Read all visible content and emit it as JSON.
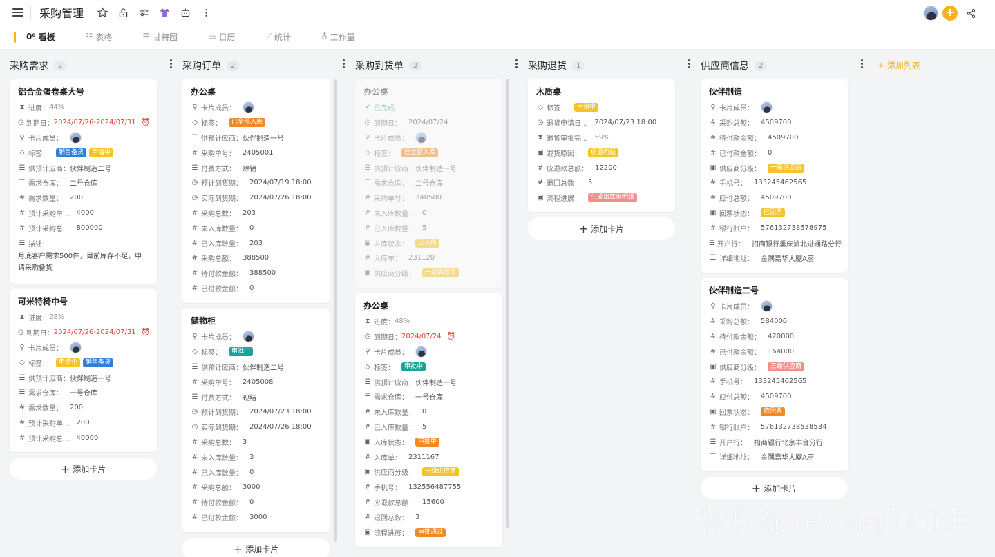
{
  "app": {
    "title": "采购管理"
  },
  "tabs": [
    {
      "icon": "0⁰",
      "label": "看板"
    },
    {
      "icon": "☷",
      "label": "表格"
    },
    {
      "icon": "☰",
      "label": "甘特图"
    },
    {
      "icon": "▭",
      "label": "日历"
    },
    {
      "icon": "⟋",
      "label": "统计"
    },
    {
      "icon": "♁",
      "label": "工作量"
    }
  ],
  "board": {
    "add_card_label": "添加卡片",
    "add_list_label": "添加列表",
    "columns": [
      {
        "name": "采购需求",
        "count": "2"
      },
      {
        "name": "采购订单",
        "count": "2"
      },
      {
        "name": "采购到货单",
        "count": "2"
      },
      {
        "name": "采购退货",
        "count": "1"
      },
      {
        "name": "供应商信息",
        "count": "2"
      }
    ]
  },
  "cards": {
    "c1a": {
      "title": "铝合金蛋卷桌大号",
      "progress": "44%",
      "due": "2024/07/26-2024/07/31",
      "label_progress": "进度：",
      "label_due": "到期日：",
      "label_member": "卡片成员：",
      "label_tag": "标签：",
      "tags": [
        "销售备货",
        "申请中"
      ],
      "label_supplier": "供预计应商：",
      "supplier": "伙伴制造二号",
      "label_warehouse": "需求仓库：",
      "warehouse": "二号仓库",
      "label_qty": "需求数量：",
      "qty": "200",
      "label_unit": "预计采购单...",
      "unit": "4000",
      "label_total": "预计采购总...",
      "total": "800000",
      "label_desc": "描述：",
      "desc": "月底客户需求500件，目前库存不足，申请采购备货"
    },
    "c1b": {
      "title": "可米特椅中号",
      "progress": "28%",
      "due": "2024/07/26-2024/07/31",
      "label_progress": "进度：",
      "label_due": "到期日：",
      "label_member": "卡片成员：",
      "label_tag": "标签：",
      "tags": [
        "申请中",
        "销售备货"
      ],
      "label_supplier": "供预计应商：",
      "supplier": "伙伴制造一号",
      "label_warehouse": "需求仓库：",
      "warehouse": "一号仓库",
      "label_qty": "需求数量：",
      "qty": "200",
      "label_unit": "预计采购单...",
      "unit": "200",
      "label_total": "预计采购总...",
      "total": "40000"
    },
    "c2a": {
      "title": "办公桌",
      "label_member": "卡片成员：",
      "label_tag": "标签：",
      "tags": [
        "已全部入库"
      ],
      "label_supplier": "供预计应商：",
      "supplier": "伙伴制造一号",
      "label_order": "采购单号：",
      "order": "2405001",
      "label_pay": "付费方式：",
      "pay": "赊销",
      "label_plan": "预计到货期：",
      "plan": "2024/07/19 18:00",
      "label_actual": "实际到货期：",
      "actual": "2024/07/26 18:00",
      "label_sum": "采购总数：",
      "sum": "203",
      "label_notin": "未入库数量：",
      "notin": "0",
      "label_in": "已入库数量：",
      "in": "203",
      "label_amount": "采购总额：",
      "amount": "388500",
      "label_topay": "待付款金额：",
      "topay": "388500",
      "label_paid": "已付款金额：",
      "paid": "0"
    },
    "c2b": {
      "title": "储物柜",
      "label_member": "卡片成员：",
      "label_tag": "标签：",
      "tags": [
        "审批中"
      ],
      "label_supplier": "供预计应商：",
      "supplier": "伙伴制造二号",
      "label_order": "采购单号：",
      "order": "2405008",
      "label_pay": "付费方式：",
      "pay": "现结",
      "label_plan": "预计到货期：",
      "plan": "2024/07/23 18:00",
      "label_actual": "实际到货期：",
      "actual": "2024/07/26 18:00",
      "label_sum": "采购总数：",
      "sum": "3",
      "label_notin": "未入库数量：",
      "notin": "3",
      "label_in": "已入库数量：",
      "in": "0",
      "label_amount": "采购总额：",
      "amount": "3000",
      "label_topay": "待付款金额：",
      "topay": "0",
      "label_paid": "已付款金额：",
      "paid": "3000"
    },
    "c3a": {
      "title": "办公桌",
      "status": "已完成",
      "label_due": "到期日：",
      "due": "2024/07/24",
      "label_member": "卡片成员：",
      "label_tag": "标签：",
      "tags": [
        "已全部入库"
      ],
      "label_supplier": "供预计应商：",
      "supplier": "伙伴制造一号",
      "label_warehouse": "需求仓库：",
      "warehouse": "二号仓库",
      "label_order": "采购单号：",
      "order": "2405001",
      "label_notin": "未入库数量：",
      "notin": "0",
      "label_in": "已入库数量：",
      "in": "5",
      "label_instatus": "入库状态：",
      "instatus": "已入库",
      "label_inno": "入库单：",
      "inno": "231120",
      "label_level": "供应商分级：",
      "level": "一级供应商"
    },
    "c3b": {
      "title": "办公桌",
      "progress": "48%",
      "due": "2024/07/24",
      "label_progress": "进度：",
      "label_due": "到期日：",
      "label_member": "卡片成员：",
      "label_tag": "标签：",
      "tags": [
        "审批中"
      ],
      "label_supplier": "供预计应商：",
      "supplier": "伙伴制造一号",
      "label_warehouse": "需求仓库：",
      "warehouse": "一号仓库",
      "label_notin": "未入库数量：",
      "notin": "0",
      "label_in": "已入库数量：",
      "in": "5",
      "label_instatus": "入库状态：",
      "instatus": "审批中",
      "label_inno": "入库单：",
      "inno": "2311167",
      "label_level": "供应商分级：",
      "level": "一级供应商",
      "label_phone": "手机号：",
      "phone": "132556487755",
      "label_refund": "应退款总额：",
      "refund": "15600",
      "label_retcount": "退回总数：",
      "retcount": "3",
      "label_flow": "流程进展：",
      "flow": "审批通过"
    },
    "c4a": {
      "title": "木质桌",
      "label_tag": "标签：",
      "tags": [
        "申请中"
      ],
      "label_retdate": "退货申请日...",
      "retdate": "2024/07/23 18:00",
      "label_retprog": "退货审批完...",
      "retprog": "59%",
      "label_reason": "退货原因：",
      "reason": "质量问题",
      "label_refund": "应退款总额：",
      "refund": "12200",
      "label_retcount": "退回总数：",
      "retcount": "5",
      "label_flow": "流程进展：",
      "flow": "生成出库单明细"
    },
    "c5a": {
      "title": "伙伴制造",
      "label_member": "卡片成员：",
      "label_amount": "采购总额：",
      "amount": "4509700",
      "label_topay": "待付款金额：",
      "topay": "4509700",
      "label_paid": "已付款金额：",
      "paid": "0",
      "label_level": "供应商分级：",
      "level": "一级供应商",
      "label_phone": "手机号：",
      "phone": "133245462565",
      "label_payable": "应付总额：",
      "payable": "4509700",
      "label_invoice": "回票状态：",
      "invoice": "已回票",
      "label_account": "银行账户：",
      "account": "576132738578975",
      "label_bank": "开户行：",
      "bank": "招商银行重庆渝北进通路分行",
      "label_addr": "详细地址：",
      "addr": "金隅嘉华大厦A座"
    },
    "c5b": {
      "title": "伙伴制造二号",
      "label_member": "卡片成员：",
      "label_amount": "采购总额：",
      "amount": "584000",
      "label_topay": "待付款金额：",
      "topay": "420000",
      "label_paid": "已付款金额：",
      "paid": "164000",
      "label_level": "供应商分级：",
      "level": "三级供应商",
      "label_phone": "手机号：",
      "phone": "133245462565",
      "label_payable": "应付总额：",
      "payable": "4509700",
      "label_invoice": "回票状态：",
      "invoice": "待回票",
      "label_account": "银行账户：",
      "account": "576132738538534",
      "label_bank": "开户行：",
      "bank": "招商银行北京丰台分行",
      "label_addr": "详细地址：",
      "addr": "金隅嘉华大厦A座"
    }
  },
  "watermark": "知乎 @yeye向阳而生",
  "colors": {
    "accent": "#f6b31b",
    "due_red": "#e0433a",
    "done_green": "#2eaa5c"
  }
}
